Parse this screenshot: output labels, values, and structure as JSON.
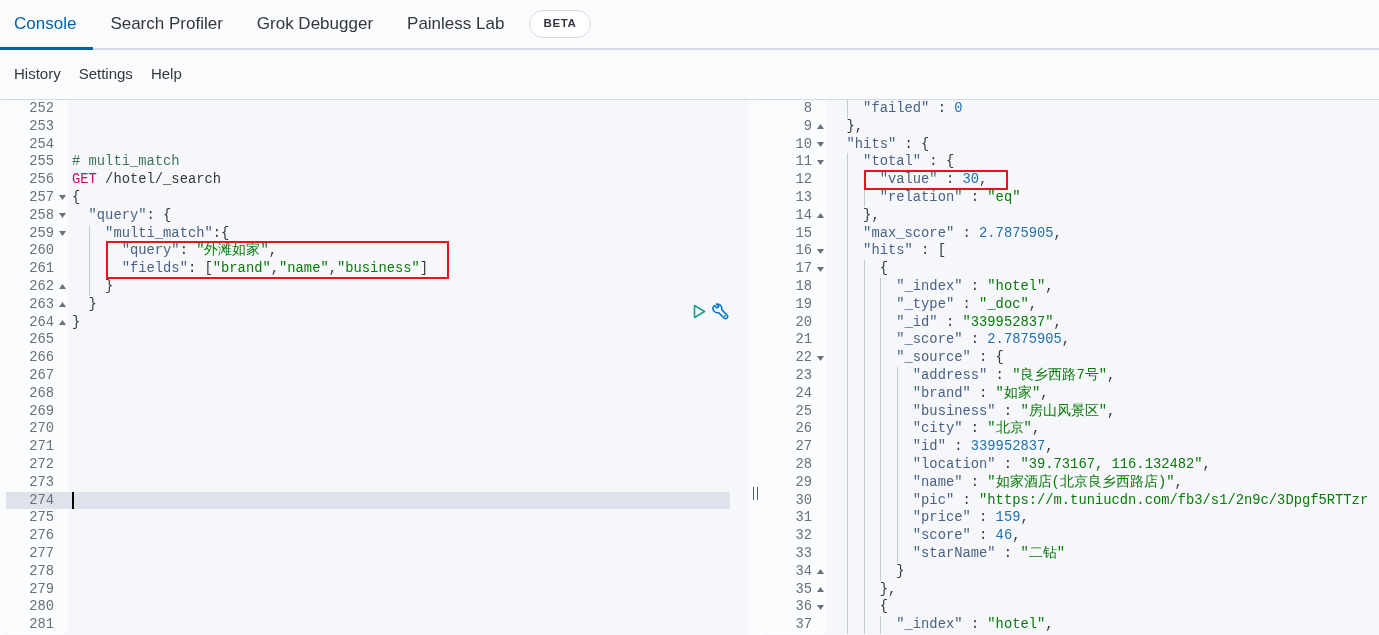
{
  "tabs": [
    {
      "label": "Console",
      "selected": true
    },
    {
      "label": "Search Profiler",
      "selected": false
    },
    {
      "label": "Grok Debugger",
      "selected": false
    },
    {
      "label": "Painless Lab",
      "selected": false,
      "badge": "BETA"
    }
  ],
  "menu": [
    "History",
    "Settings",
    "Help"
  ],
  "request_editor": {
    "lines": [
      {
        "number": "252",
        "current": false,
        "highlighted": false
      },
      {
        "number": "253",
        "current": false,
        "highlighted": false
      },
      {
        "number": "254",
        "current": false,
        "highlighted": false
      },
      {
        "number": "255",
        "current": false,
        "highlighted": false,
        "tokens": [
          {
            "kind": "comment",
            "text": "# multi_match"
          }
        ]
      },
      {
        "number": "256",
        "current": false,
        "highlighted": false,
        "tokens": [
          {
            "kind": "method",
            "text": "GET"
          },
          {
            "kind": "path",
            "text": " /hotel/_search"
          }
        ]
      },
      {
        "number": "257",
        "current": false,
        "highlighted": false,
        "fold_start": true,
        "tokens": [
          {
            "kind": "punct",
            "text": "{"
          }
        ]
      },
      {
        "number": "258",
        "current": false,
        "highlighted": false,
        "fold_start": true,
        "tokens": [
          {
            "kind": "key",
            "text": "  \"query\""
          },
          {
            "kind": "punct",
            "text": ": {"
          }
        ]
      },
      {
        "number": "259",
        "current": false,
        "highlighted": false,
        "fold_start": true,
        "tokens": [
          {
            "kind": "key",
            "text": "    \"multi_match\""
          },
          {
            "kind": "punct",
            "text": ":{"
          }
        ]
      },
      {
        "number": "260",
        "current": false,
        "highlighted": true,
        "tokens": [
          {
            "kind": "key",
            "text": "      \"query\""
          },
          {
            "kind": "punct",
            "text": ": "
          },
          {
            "kind": "string",
            "text": "\"外滩如家\""
          },
          {
            "kind": "punct",
            "text": ","
          }
        ]
      },
      {
        "number": "261",
        "current": false,
        "highlighted": true,
        "tokens": [
          {
            "kind": "key",
            "text": "      \"fields\""
          },
          {
            "kind": "punct",
            "text": ": ["
          },
          {
            "kind": "string",
            "text": "\"brand\""
          },
          {
            "kind": "punct",
            "text": ","
          },
          {
            "kind": "string",
            "text": "\"name\""
          },
          {
            "kind": "punct",
            "text": ","
          },
          {
            "kind": "string",
            "text": "\"business\""
          },
          {
            "kind": "punct",
            "text": "]"
          }
        ]
      },
      {
        "number": "262",
        "current": false,
        "highlighted": false,
        "fold_end": true,
        "tokens": [
          {
            "kind": "punct",
            "text": "    }"
          }
        ]
      },
      {
        "number": "263",
        "current": false,
        "highlighted": false,
        "fold_end": true,
        "tokens": [
          {
            "kind": "punct",
            "text": "  }"
          }
        ]
      },
      {
        "number": "264",
        "current": false,
        "highlighted": false,
        "fold_end": true,
        "tokens": [
          {
            "kind": "punct",
            "text": "}"
          }
        ]
      },
      {
        "number": "265",
        "current": false,
        "highlighted": false
      },
      {
        "number": "266",
        "current": false,
        "highlighted": false
      },
      {
        "number": "267",
        "current": false,
        "highlighted": false
      },
      {
        "number": "268",
        "current": false,
        "highlighted": false
      },
      {
        "number": "269",
        "current": false,
        "highlighted": false
      },
      {
        "number": "270",
        "current": false,
        "highlighted": false
      },
      {
        "number": "271",
        "current": false,
        "highlighted": false
      },
      {
        "number": "272",
        "current": false,
        "highlighted": false
      },
      {
        "number": "273",
        "current": false,
        "highlighted": false
      },
      {
        "number": "274",
        "current": true,
        "highlighted": false
      },
      {
        "number": "275",
        "current": false,
        "highlighted": false
      },
      {
        "number": "276",
        "current": false,
        "highlighted": false
      },
      {
        "number": "277",
        "current": false,
        "highlighted": false
      },
      {
        "number": "278",
        "current": false,
        "highlighted": false
      },
      {
        "number": "279",
        "current": false,
        "highlighted": false
      },
      {
        "number": "280",
        "current": false,
        "highlighted": false
      },
      {
        "number": "281",
        "current": false,
        "highlighted": false
      }
    ]
  },
  "response_editor": {
    "lines": [
      {
        "number": "8",
        "current": false,
        "highlighted": false,
        "tokens": [
          {
            "kind": "key",
            "text": "    \"failed\""
          },
          {
            "kind": "punct",
            "text": " : "
          },
          {
            "kind": "number",
            "text": "0"
          }
        ]
      },
      {
        "number": "9",
        "current": false,
        "highlighted": false,
        "fold_end": true,
        "tokens": [
          {
            "kind": "punct",
            "text": "  },"
          }
        ]
      },
      {
        "number": "10",
        "current": false,
        "highlighted": false,
        "fold_start": true,
        "tokens": [
          {
            "kind": "key",
            "text": "  \"hits\""
          },
          {
            "kind": "punct",
            "text": " : {"
          }
        ]
      },
      {
        "number": "11",
        "current": false,
        "highlighted": false,
        "fold_start": true,
        "tokens": [
          {
            "kind": "key",
            "text": "    \"total\""
          },
          {
            "kind": "punct",
            "text": " : {"
          }
        ]
      },
      {
        "number": "12",
        "current": false,
        "highlighted": true,
        "tokens": [
          {
            "kind": "key",
            "text": "      \"value\""
          },
          {
            "kind": "punct",
            "text": " : "
          },
          {
            "kind": "number",
            "text": "30"
          },
          {
            "kind": "punct",
            "text": ","
          }
        ]
      },
      {
        "number": "13",
        "current": false,
        "highlighted": false,
        "tokens": [
          {
            "kind": "key",
            "text": "      \"relation\""
          },
          {
            "kind": "punct",
            "text": " : "
          },
          {
            "kind": "string",
            "text": "\"eq\""
          }
        ]
      },
      {
        "number": "14",
        "current": false,
        "highlighted": false,
        "fold_end": true,
        "tokens": [
          {
            "kind": "punct",
            "text": "    },"
          }
        ]
      },
      {
        "number": "15",
        "current": false,
        "highlighted": false,
        "tokens": [
          {
            "kind": "key",
            "text": "    \"max_score\""
          },
          {
            "kind": "punct",
            "text": " : "
          },
          {
            "kind": "number",
            "text": "2.7875905"
          },
          {
            "kind": "punct",
            "text": ","
          }
        ]
      },
      {
        "number": "16",
        "current": false,
        "highlighted": false,
        "fold_start": true,
        "tokens": [
          {
            "kind": "key",
            "text": "    \"hits\""
          },
          {
            "kind": "punct",
            "text": " : ["
          }
        ]
      },
      {
        "number": "17",
        "current": false,
        "highlighted": false,
        "fold_start": true,
        "tokens": [
          {
            "kind": "punct",
            "text": "      {"
          }
        ]
      },
      {
        "number": "18",
        "current": false,
        "highlighted": false,
        "tokens": [
          {
            "kind": "key",
            "text": "        \"_index\""
          },
          {
            "kind": "punct",
            "text": " : "
          },
          {
            "kind": "string",
            "text": "\"hotel\""
          },
          {
            "kind": "punct",
            "text": ","
          }
        ]
      },
      {
        "number": "19",
        "current": false,
        "highlighted": false,
        "tokens": [
          {
            "kind": "key",
            "text": "        \"_type\""
          },
          {
            "kind": "punct",
            "text": " : "
          },
          {
            "kind": "string",
            "text": "\"_doc\""
          },
          {
            "kind": "punct",
            "text": ","
          }
        ]
      },
      {
        "number": "20",
        "current": false,
        "highlighted": false,
        "tokens": [
          {
            "kind": "key",
            "text": "        \"_id\""
          },
          {
            "kind": "punct",
            "text": " : "
          },
          {
            "kind": "string",
            "text": "\"339952837\""
          },
          {
            "kind": "punct",
            "text": ","
          }
        ]
      },
      {
        "number": "21",
        "current": false,
        "highlighted": false,
        "tokens": [
          {
            "kind": "key",
            "text": "        \"_score\""
          },
          {
            "kind": "punct",
            "text": " : "
          },
          {
            "kind": "number",
            "text": "2.7875905"
          },
          {
            "kind": "punct",
            "text": ","
          }
        ]
      },
      {
        "number": "22",
        "current": false,
        "highlighted": false,
        "fold_start": true,
        "tokens": [
          {
            "kind": "key",
            "text": "        \"_source\""
          },
          {
            "kind": "punct",
            "text": " : {"
          }
        ]
      },
      {
        "number": "23",
        "current": false,
        "highlighted": false,
        "tokens": [
          {
            "kind": "key",
            "text": "          \"address\""
          },
          {
            "kind": "punct",
            "text": " : "
          },
          {
            "kind": "string",
            "text": "\"良乡西路7号\""
          },
          {
            "kind": "punct",
            "text": ","
          }
        ]
      },
      {
        "number": "24",
        "current": false,
        "highlighted": false,
        "tokens": [
          {
            "kind": "key",
            "text": "          \"brand\""
          },
          {
            "kind": "punct",
            "text": " : "
          },
          {
            "kind": "string",
            "text": "\"如家\""
          },
          {
            "kind": "punct",
            "text": ","
          }
        ]
      },
      {
        "number": "25",
        "current": false,
        "highlighted": false,
        "tokens": [
          {
            "kind": "key",
            "text": "          \"business\""
          },
          {
            "kind": "punct",
            "text": " : "
          },
          {
            "kind": "string",
            "text": "\"房山风景区\""
          },
          {
            "kind": "punct",
            "text": ","
          }
        ]
      },
      {
        "number": "26",
        "current": false,
        "highlighted": false,
        "tokens": [
          {
            "kind": "key",
            "text": "          \"city\""
          },
          {
            "kind": "punct",
            "text": " : "
          },
          {
            "kind": "string",
            "text": "\"北京\""
          },
          {
            "kind": "punct",
            "text": ","
          }
        ]
      },
      {
        "number": "27",
        "current": false,
        "highlighted": false,
        "tokens": [
          {
            "kind": "key",
            "text": "          \"id\""
          },
          {
            "kind": "punct",
            "text": " : "
          },
          {
            "kind": "number",
            "text": "339952837"
          },
          {
            "kind": "punct",
            "text": ","
          }
        ]
      },
      {
        "number": "28",
        "current": false,
        "highlighted": false,
        "tokens": [
          {
            "kind": "key",
            "text": "          \"location\""
          },
          {
            "kind": "punct",
            "text": " : "
          },
          {
            "kind": "string",
            "text": "\"39.73167, 116.132482\""
          },
          {
            "kind": "punct",
            "text": ","
          }
        ]
      },
      {
        "number": "29",
        "current": false,
        "highlighted": false,
        "tokens": [
          {
            "kind": "key",
            "text": "          \"name\""
          },
          {
            "kind": "punct",
            "text": " : "
          },
          {
            "kind": "string",
            "text": "\"如家酒店(北京良乡西路店)\""
          },
          {
            "kind": "punct",
            "text": ","
          }
        ]
      },
      {
        "number": "30",
        "current": false,
        "highlighted": false,
        "tokens": [
          {
            "kind": "key",
            "text": "          \"pic\""
          },
          {
            "kind": "punct",
            "text": " : "
          },
          {
            "kind": "string",
            "text": "\"https://m.tuniucdn.com/fb3/s1/2n9c/3Dpgf5RTTzr"
          }
        ]
      },
      {
        "number": "31",
        "current": false,
        "highlighted": false,
        "tokens": [
          {
            "kind": "key",
            "text": "          \"price\""
          },
          {
            "kind": "punct",
            "text": " : "
          },
          {
            "kind": "number",
            "text": "159"
          },
          {
            "kind": "punct",
            "text": ","
          }
        ]
      },
      {
        "number": "32",
        "current": false,
        "highlighted": false,
        "tokens": [
          {
            "kind": "key",
            "text": "          \"score\""
          },
          {
            "kind": "punct",
            "text": " : "
          },
          {
            "kind": "number",
            "text": "46"
          },
          {
            "kind": "punct",
            "text": ","
          }
        ]
      },
      {
        "number": "33",
        "current": false,
        "highlighted": false,
        "tokens": [
          {
            "kind": "key",
            "text": "          \"starName\""
          },
          {
            "kind": "punct",
            "text": " : "
          },
          {
            "kind": "string",
            "text": "\"二钻\""
          }
        ]
      },
      {
        "number": "34",
        "current": false,
        "highlighted": false,
        "fold_end": true,
        "tokens": [
          {
            "kind": "punct",
            "text": "        }"
          }
        ]
      },
      {
        "number": "35",
        "current": false,
        "highlighted": false,
        "fold_end": true,
        "tokens": [
          {
            "kind": "punct",
            "text": "      },"
          }
        ]
      },
      {
        "number": "36",
        "current": false,
        "highlighted": false,
        "fold_start": true,
        "tokens": [
          {
            "kind": "punct",
            "text": "      {"
          }
        ]
      },
      {
        "number": "37",
        "current": false,
        "highlighted": false,
        "tokens": [
          {
            "kind": "key",
            "text": "        \"_index\""
          },
          {
            "kind": "punct",
            "text": " : "
          },
          {
            "kind": "string",
            "text": "\"hotel\""
          },
          {
            "kind": "punct",
            "text": ","
          }
        ]
      }
    ]
  }
}
